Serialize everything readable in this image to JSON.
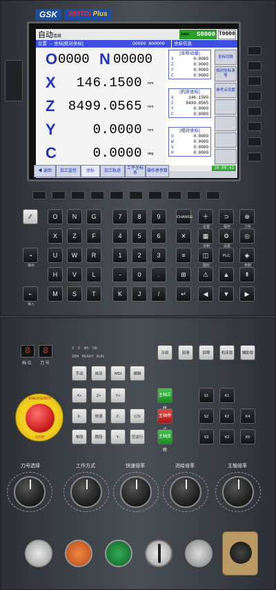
{
  "brand": {
    "logo": "GSK",
    "model_a": "980TDi",
    "model_b": "Plus"
  },
  "screen": {
    "mode": "自动",
    "mode_sub": "连续",
    "spindle_pct": "100%",
    "spindle_code": "S0000",
    "tool_code": "T0000",
    "title_left": "位置 → 坐标[绝对坐标]",
    "title_prog": "O0000 N00000",
    "title_right": "坐标信息",
    "o_axis": "O",
    "o_value": "0000",
    "n_axis": "N",
    "n_value": "00000",
    "coords": [
      {
        "axis": "X",
        "value": "146.1500",
        "unit": "mm"
      },
      {
        "axis": "Z",
        "value": "8499.0565",
        "unit": "mm"
      },
      {
        "axis": "Y",
        "value": "0.0000",
        "unit": "mm"
      },
      {
        "axis": "C",
        "value": "0.0000",
        "unit": "deg"
      }
    ],
    "move_group": {
      "header": "[余移动量]",
      "rows": [
        {
          "a": "X",
          "v": "0.0000"
        },
        {
          "a": "Z",
          "v": "0.0000"
        },
        {
          "a": "Y",
          "v": "0.0000"
        },
        {
          "a": "C",
          "v": "0.0000"
        }
      ]
    },
    "machine_group": {
      "header": "[机床坐标]",
      "rows": [
        {
          "a": "X",
          "v": "146.1500"
        },
        {
          "a": "Z",
          "v": "8499.0565"
        },
        {
          "a": "Y",
          "v": "0.0000"
        },
        {
          "a": "C",
          "v": "0.0000"
        }
      ]
    },
    "relative_group": {
      "header": "[相对坐标]",
      "rows": [
        {
          "a": "U",
          "v": "0.0000"
        },
        {
          "a": "W",
          "v": "0.0000"
        },
        {
          "a": "V",
          "v": "0.0000"
        },
        {
          "a": "H",
          "v": "0.0000"
        }
      ]
    },
    "softkeys_right": [
      "坐标切换",
      "相对坐标清零",
      "参考点设置"
    ],
    "time": "16:08:41",
    "tabs": [
      {
        "label": "◀ 返回"
      },
      {
        "label": "加工监控"
      },
      {
        "label": "坐标"
      },
      {
        "label": "加工轨迹"
      },
      {
        "label": "工件坐标系"
      },
      {
        "label": "操作者参数"
      }
    ]
  },
  "keypad": {
    "letters": [
      [
        "O",
        "N",
        "G",
        "7",
        "8",
        "9"
      ],
      [
        "X",
        "Z",
        "F",
        "4",
        "5",
        "6"
      ],
      [
        "U",
        "W",
        "R",
        "1",
        "2",
        "3"
      ],
      [
        "H",
        "V",
        "L",
        "-",
        "0",
        "."
      ],
      [
        "M",
        "S",
        "T",
        "K",
        "J",
        "/"
      ]
    ],
    "func_labels": [
      "CHANGE",
      "位置",
      "程序",
      "刀补",
      "诊断",
      "设置",
      "图形",
      "PLC",
      "参数",
      "报警"
    ],
    "left_labels": [
      "上档",
      "输出",
      "输入"
    ]
  },
  "panel": {
    "tool_seg": [
      "8",
      "8"
    ],
    "seg_labels": [
      "档 位",
      "刀 号"
    ],
    "led_labels": [
      "X",
      "Z",
      "4th",
      "5th",
      "ZRN",
      "READY",
      "RUN",
      "XAM",
      "LOC",
      "HALT"
    ],
    "estop_text": [
      "EMERGENCY",
      "STOP"
    ],
    "knob_labels": [
      "刀号选择",
      "工作方式",
      "快速倍率",
      "进给倍率",
      "主轴倍率"
    ],
    "mode_keys": [
      "手动",
      "自动",
      "MDI",
      "编辑",
      "回零",
      "单段",
      "跳段",
      "机床锁",
      "辅助锁",
      "空运行"
    ],
    "axis_keys": [
      "X+",
      "X-",
      "Z+",
      "Z-",
      "Y+",
      "Y-",
      "快速",
      "C/S"
    ],
    "aux_keys": [
      "冷却",
      "润滑",
      "主轴正转",
      "主轴停止",
      "主轴反转",
      "S1",
      "S2",
      "S3",
      "K1",
      "K2",
      "K3",
      "K4",
      "K5"
    ],
    "bottom_labels": [
      "循环启动",
      "进给保持",
      "程序启动"
    ]
  }
}
